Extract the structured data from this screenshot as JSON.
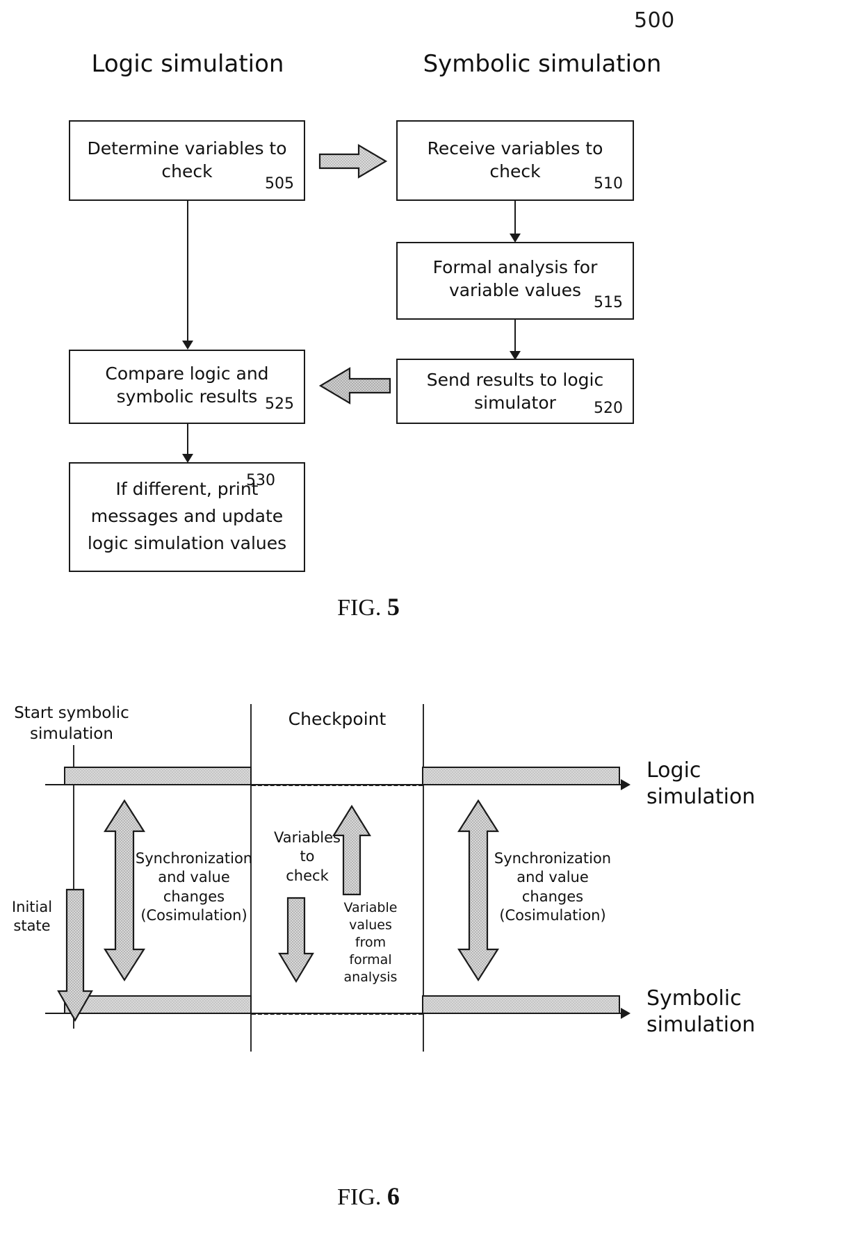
{
  "page": {
    "figure_group_number": "500"
  },
  "fig5": {
    "caption_prefix": "FIG.",
    "caption_number": "5",
    "columns": {
      "left_title": "Logic simulation",
      "right_title": "Symbolic simulation"
    },
    "boxes": [
      {
        "id": "b505",
        "text_lines": [
          "Determine variables to",
          "check"
        ],
        "ref": "505"
      },
      {
        "id": "b510",
        "text_lines": [
          "Receive variables to",
          "check"
        ],
        "ref": "510"
      },
      {
        "id": "b515",
        "text_lines": [
          "Formal analysis for",
          "variable values"
        ],
        "ref": "515"
      },
      {
        "id": "b520",
        "text_lines": [
          "Send results to logic",
          "simulator"
        ],
        "ref": "520"
      },
      {
        "id": "b525",
        "text_lines": [
          "Compare logic and",
          "symbolic results"
        ],
        "ref": "525"
      },
      {
        "id": "b530",
        "text_lines": [
          "If different, print",
          "messages and update",
          "logic simulation values"
        ],
        "ref": "530"
      }
    ],
    "connectors": [
      {
        "id": "arrow-505-to-510",
        "kind": "block-arrow",
        "direction": "right"
      },
      {
        "id": "arrow-510-to-515",
        "kind": "thin-arrow",
        "direction": "down"
      },
      {
        "id": "arrow-515-to-520",
        "kind": "thin-arrow",
        "direction": "down"
      },
      {
        "id": "arrow-520-to-525",
        "kind": "block-arrow",
        "direction": "left"
      },
      {
        "id": "arrow-505-to-525",
        "kind": "thin-arrow",
        "direction": "down"
      },
      {
        "id": "arrow-525-to-530",
        "kind": "thin-arrow",
        "direction": "down"
      }
    ]
  },
  "fig6": {
    "caption_prefix": "FIG.",
    "caption_number": "6",
    "markers": {
      "start": [
        "Start symbolic",
        "simulation"
      ],
      "checkpoint": "Checkpoint"
    },
    "axes": {
      "top": [
        "Logic",
        "simulation"
      ],
      "bottom": [
        "Symbolic",
        "simulation"
      ]
    },
    "annotations": {
      "initial_state": [
        "Initial",
        "state"
      ],
      "sync_left": [
        "Synchronization",
        "and value",
        "changes",
        "(Cosimulation)"
      ],
      "sync_right": [
        "Synchronization",
        "and value",
        "changes",
        "(Cosimulation)"
      ],
      "variables_to_check": [
        "Variables",
        "to",
        "check"
      ],
      "variable_values": [
        "Variable",
        "values",
        "from",
        "formal",
        "analysis"
      ]
    }
  },
  "colors": {
    "ink": "#1a1a1a",
    "shade": "#d9d9d9"
  }
}
